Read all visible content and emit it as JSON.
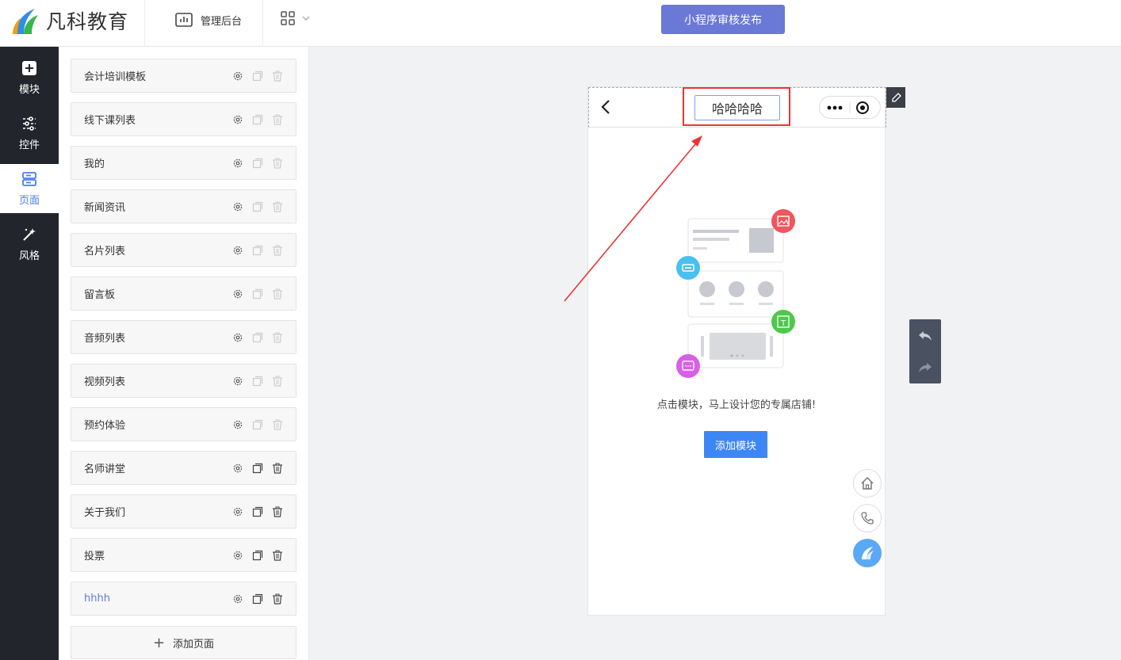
{
  "header": {
    "logo_text": "凡科教育",
    "admin_label": "管理后台",
    "publish_label": "小程序审核发布"
  },
  "sidebar": {
    "items": [
      {
        "label": "模块",
        "icon": "plus-square-icon"
      },
      {
        "label": "控件",
        "icon": "sliders-icon"
      },
      {
        "label": "页面",
        "icon": "page-layout-icon",
        "active": true
      },
      {
        "label": "风格",
        "icon": "magic-wand-icon"
      }
    ]
  },
  "pages": {
    "items": [
      {
        "label": "会计培训模板"
      },
      {
        "label": "线下课列表"
      },
      {
        "label": "我的"
      },
      {
        "label": "新闻资讯"
      },
      {
        "label": "名片列表"
      },
      {
        "label": "留言板"
      },
      {
        "label": "音频列表"
      },
      {
        "label": "视频列表"
      },
      {
        "label": "预约体验"
      },
      {
        "label": "名师讲堂"
      },
      {
        "label": "关于我们"
      },
      {
        "label": "投票"
      },
      {
        "label": "hhhh"
      }
    ],
    "add_label": "添加页面"
  },
  "phone": {
    "title": "哈哈哈哈",
    "empty_hint": "点击模块，马上设计您的专属店铺!",
    "add_module_label": "添加模块"
  },
  "colors": {
    "accent": "#3c87f5",
    "publish": "#6a79d6",
    "sidebar_bg": "#22252b",
    "annotation_red": "#e33333"
  }
}
